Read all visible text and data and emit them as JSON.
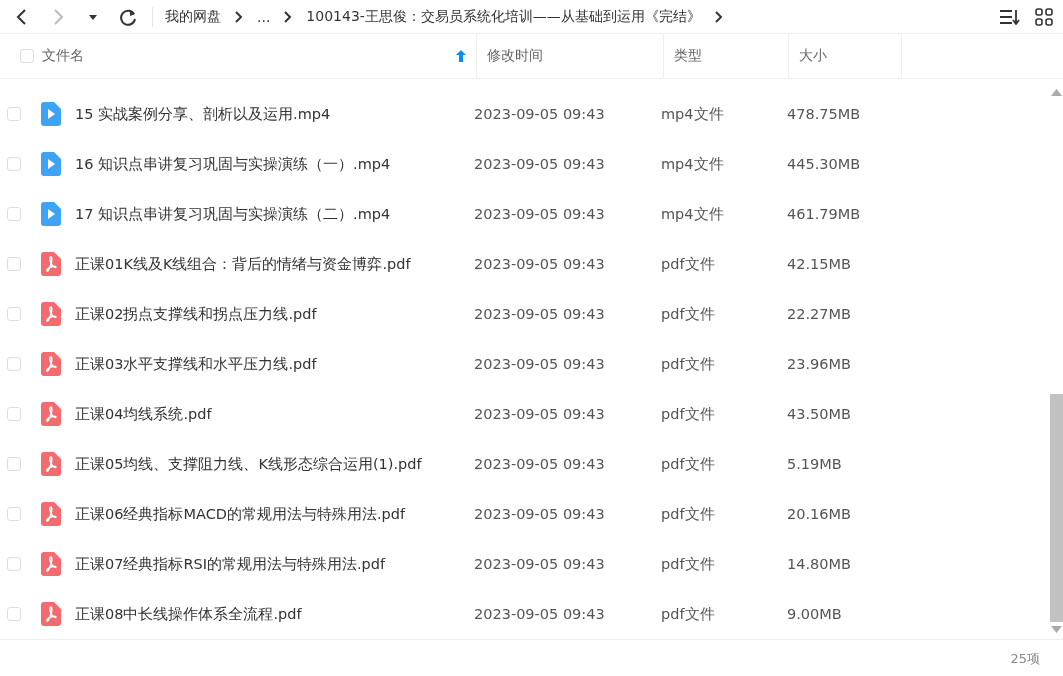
{
  "toolbar": {
    "nav": [
      {
        "kind": "back",
        "disabled": false
      },
      {
        "kind": "forward",
        "disabled": true
      },
      {
        "kind": "history",
        "disabled": false
      },
      {
        "kind": "refresh",
        "disabled": false
      }
    ],
    "breadcrumb": [
      "我的网盘",
      "...",
      "100143-王思俊：交易员系统化培训——从基础到运用《完结》"
    ]
  },
  "table": {
    "select_all": {
      "checked": false
    },
    "columns": [
      {
        "label": "文件名",
        "sorted": true
      },
      {
        "label": "修改时间",
        "sorted": false
      },
      {
        "label": "类型",
        "sorted": false
      },
      {
        "label": "大小",
        "sorted": false
      }
    ],
    "rows": [
      {
        "kind": "video",
        "checked": false,
        "name": "15 实战案例分享、剖析以及运用.mp4",
        "modified": "2023-09-05 09:43",
        "type": "mp4文件",
        "size": "478.75MB"
      },
      {
        "kind": "video",
        "checked": false,
        "name": "16 知识点串讲复习巩固与实操演练（一）.mp4",
        "modified": "2023-09-05 09:43",
        "type": "mp4文件",
        "size": "445.30MB"
      },
      {
        "kind": "video",
        "checked": false,
        "name": "17 知识点串讲复习巩固与实操演练（二）.mp4",
        "modified": "2023-09-05 09:43",
        "type": "mp4文件",
        "size": "461.79MB"
      },
      {
        "kind": "pdf",
        "checked": false,
        "name": "正课01K线及K线组合：背后的情绪与资金博弈.pdf",
        "modified": "2023-09-05 09:43",
        "type": "pdf文件",
        "size": "42.15MB"
      },
      {
        "kind": "pdf",
        "checked": false,
        "name": "正课02拐点支撑线和拐点压力线.pdf",
        "modified": "2023-09-05 09:43",
        "type": "pdf文件",
        "size": "22.27MB"
      },
      {
        "kind": "pdf",
        "checked": false,
        "name": "正课03水平支撑线和水平压力线.pdf",
        "modified": "2023-09-05 09:43",
        "type": "pdf文件",
        "size": "23.96MB"
      },
      {
        "kind": "pdf",
        "checked": false,
        "name": "正课04均线系统.pdf",
        "modified": "2023-09-05 09:43",
        "type": "pdf文件",
        "size": "43.50MB"
      },
      {
        "kind": "pdf",
        "checked": false,
        "name": "正课05均线、支撑阻力线、K线形态综合运用(1).pdf",
        "modified": "2023-09-05 09:43",
        "type": "pdf文件",
        "size": "5.19MB"
      },
      {
        "kind": "pdf",
        "checked": false,
        "name": "正课06经典指标MACD的常规用法与特殊用法.pdf",
        "modified": "2023-09-05 09:43",
        "type": "pdf文件",
        "size": "20.16MB"
      },
      {
        "kind": "pdf",
        "checked": false,
        "name": "正课07经典指标RSI的常规用法与特殊用法.pdf",
        "modified": "2023-09-05 09:43",
        "type": "pdf文件",
        "size": "14.80MB"
      },
      {
        "kind": "pdf",
        "checked": false,
        "name": "正课08中长线操作体系全流程.pdf",
        "modified": "2023-09-05 09:43",
        "type": "pdf文件",
        "size": "9.00MB"
      }
    ]
  },
  "status_bar": {
    "count": "25项"
  }
}
